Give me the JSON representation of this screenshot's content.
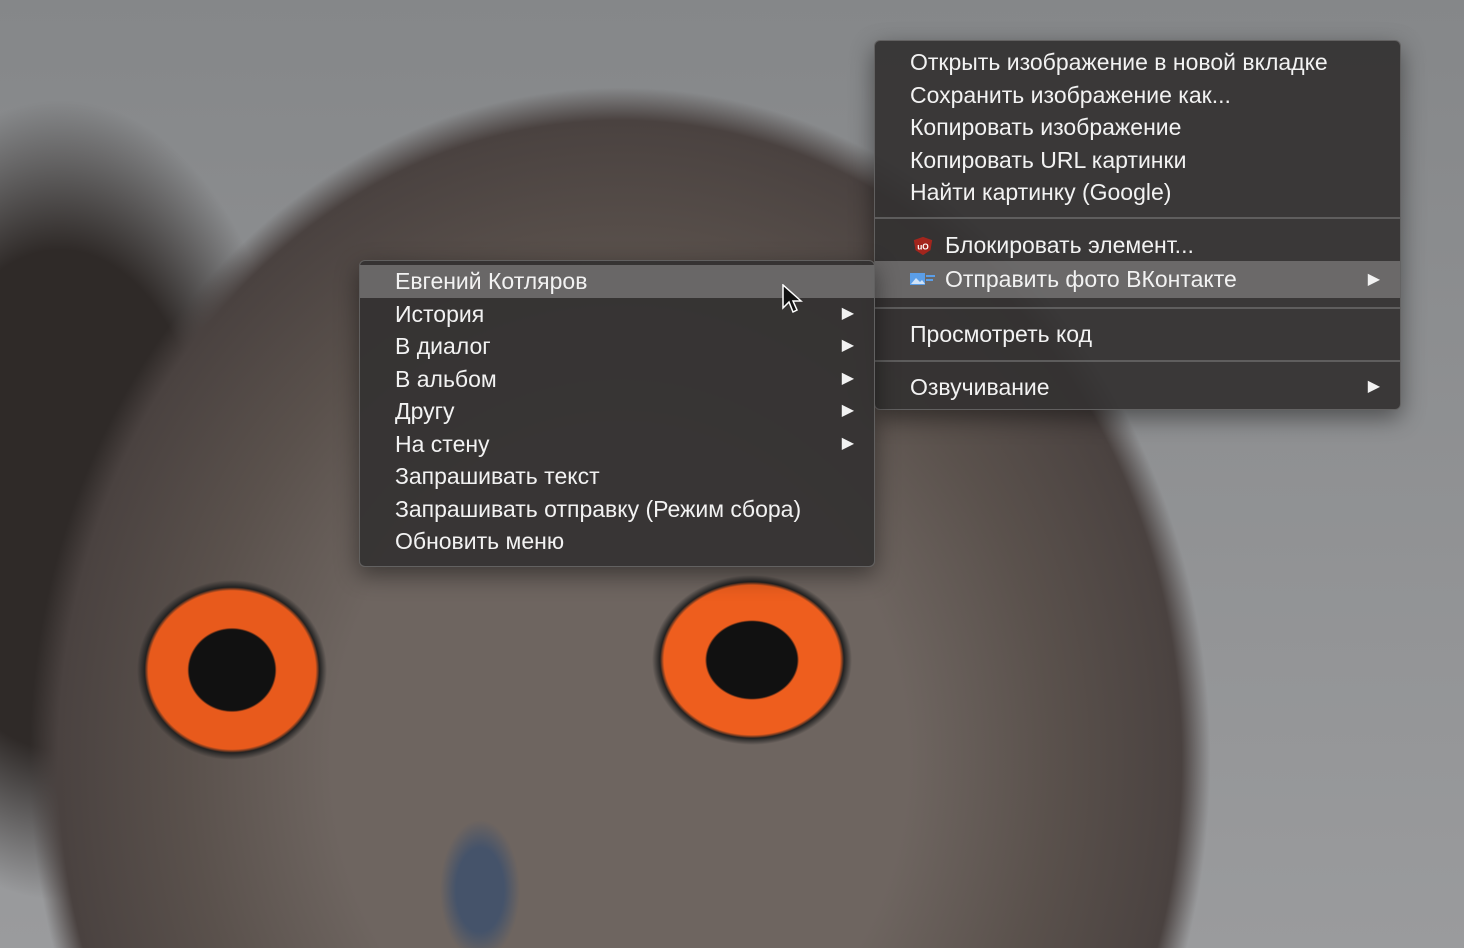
{
  "main_menu": {
    "items": [
      {
        "label": "Открыть изображение в новой вкладке"
      },
      {
        "label": "Сохранить изображение как..."
      },
      {
        "label": "Копировать изображение"
      },
      {
        "label": "Копировать URL картинки"
      },
      {
        "label": "Найти картинку (Google)"
      },
      {
        "label": "Блокировать элемент...",
        "icon": "ublock-shield-icon"
      },
      {
        "label": "Отправить фото ВКонтакте",
        "icon": "vk-photo-icon",
        "submenu": true,
        "highlighted": true
      },
      {
        "label": "Просмотреть код"
      },
      {
        "label": "Озвучивание",
        "submenu": true
      }
    ]
  },
  "sub_menu": {
    "items": [
      {
        "label": "Евгений Котляров",
        "highlighted": true
      },
      {
        "label": "История",
        "submenu": true
      },
      {
        "label": "В диалог",
        "submenu": true
      },
      {
        "label": "В альбом",
        "submenu": true
      },
      {
        "label": "Другу",
        "submenu": true
      },
      {
        "label": "На стену",
        "submenu": true
      },
      {
        "label": "Запрашивать текст"
      },
      {
        "label": "Запрашивать отправку (Режим сбора)"
      },
      {
        "label": "Обновить меню"
      }
    ]
  },
  "arrow_glyph": "▶"
}
